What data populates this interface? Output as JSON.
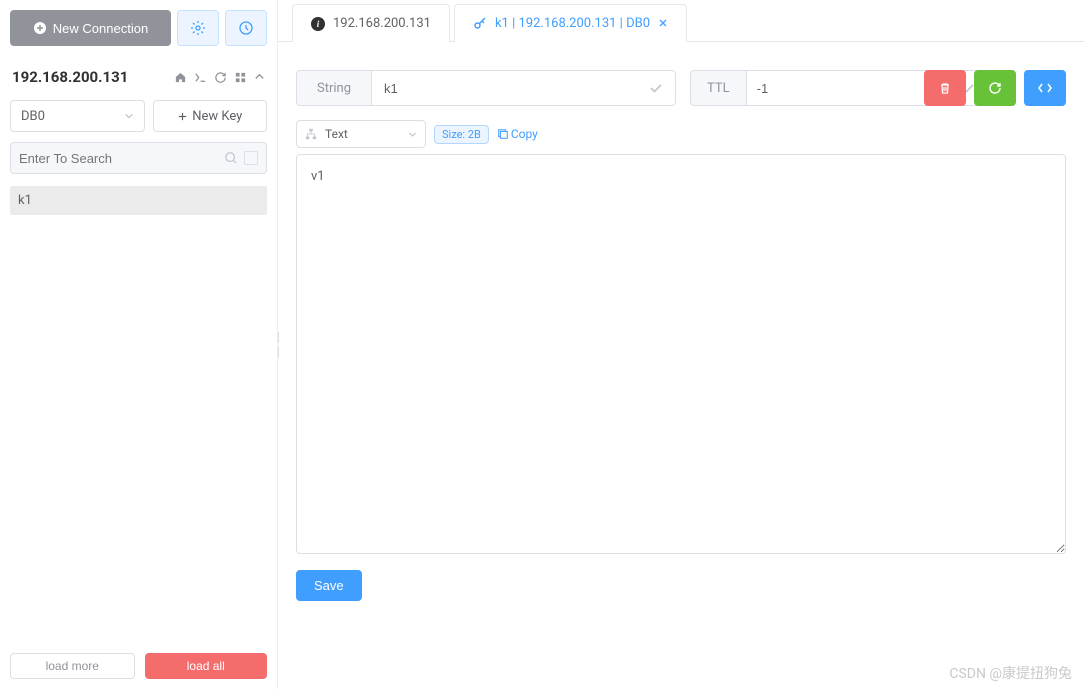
{
  "sidebar": {
    "new_connection_label": "New Connection",
    "connection_title": "192.168.200.131",
    "db_select": "DB0",
    "new_key_label": "New Key",
    "search_placeholder": "Enter To Search",
    "keys": [
      "k1"
    ],
    "load_more_label": "load more",
    "load_all_label": "load all"
  },
  "tabs": [
    {
      "label": "192.168.200.131",
      "active": false,
      "closable": false,
      "icon": "info-icon"
    },
    {
      "label": "k1 | 192.168.200.131 | DB0",
      "active": true,
      "closable": true,
      "icon": "key-icon"
    }
  ],
  "editor": {
    "type_label": "String",
    "key_name": "k1",
    "ttl_label": "TTL",
    "ttl_value": "-1",
    "format_label": "Text",
    "size_label": "Size: 2B",
    "copy_label": "Copy",
    "value": "v1",
    "save_label": "Save"
  },
  "watermark": "CSDN @康提扭狗兔",
  "colors": {
    "primary": "#409eff",
    "danger": "#f56c6c",
    "success": "#67c23a",
    "grey": "#909399"
  }
}
